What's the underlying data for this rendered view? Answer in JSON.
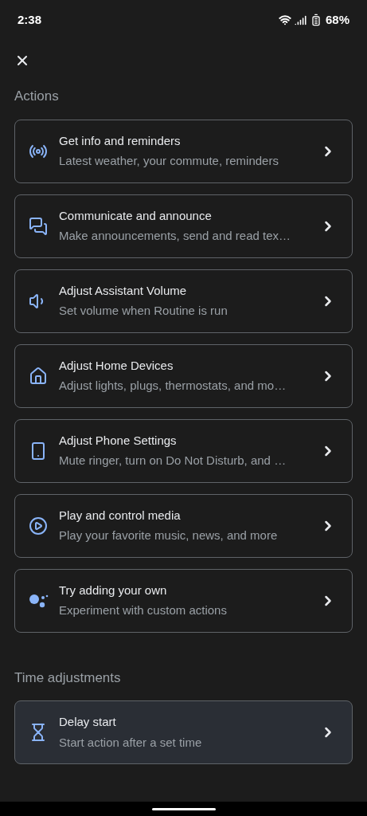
{
  "status_bar": {
    "time": "2:38",
    "battery": "68%"
  },
  "sections": [
    {
      "title": "Actions",
      "items": [
        {
          "kind": "broadcast",
          "title": "Get info and reminders",
          "subtitle": "Latest weather, your commute, reminders",
          "selected": false
        },
        {
          "kind": "chat",
          "title": "Communicate and announce",
          "subtitle": "Make announcements, send and read tex…",
          "selected": false
        },
        {
          "kind": "volume",
          "title": "Adjust Assistant Volume",
          "subtitle": "Set volume when Routine is run",
          "selected": false
        },
        {
          "kind": "home",
          "title": "Adjust Home Devices",
          "subtitle": "Adjust lights, plugs, thermostats, and mo…",
          "selected": false
        },
        {
          "kind": "phone",
          "title": "Adjust Phone Settings",
          "subtitle": "Mute ringer, turn on Do Not Disturb, and …",
          "selected": false
        },
        {
          "kind": "play",
          "title": "Play and control media",
          "subtitle": "Play your favorite music, news, and more",
          "selected": false
        },
        {
          "kind": "assistant",
          "title": "Try adding your own",
          "subtitle": "Experiment with custom actions",
          "selected": false
        }
      ]
    },
    {
      "title": "Time adjustments",
      "items": [
        {
          "kind": "hourglass",
          "title": "Delay start",
          "subtitle": "Start action after a set time",
          "selected": true
        }
      ]
    }
  ]
}
